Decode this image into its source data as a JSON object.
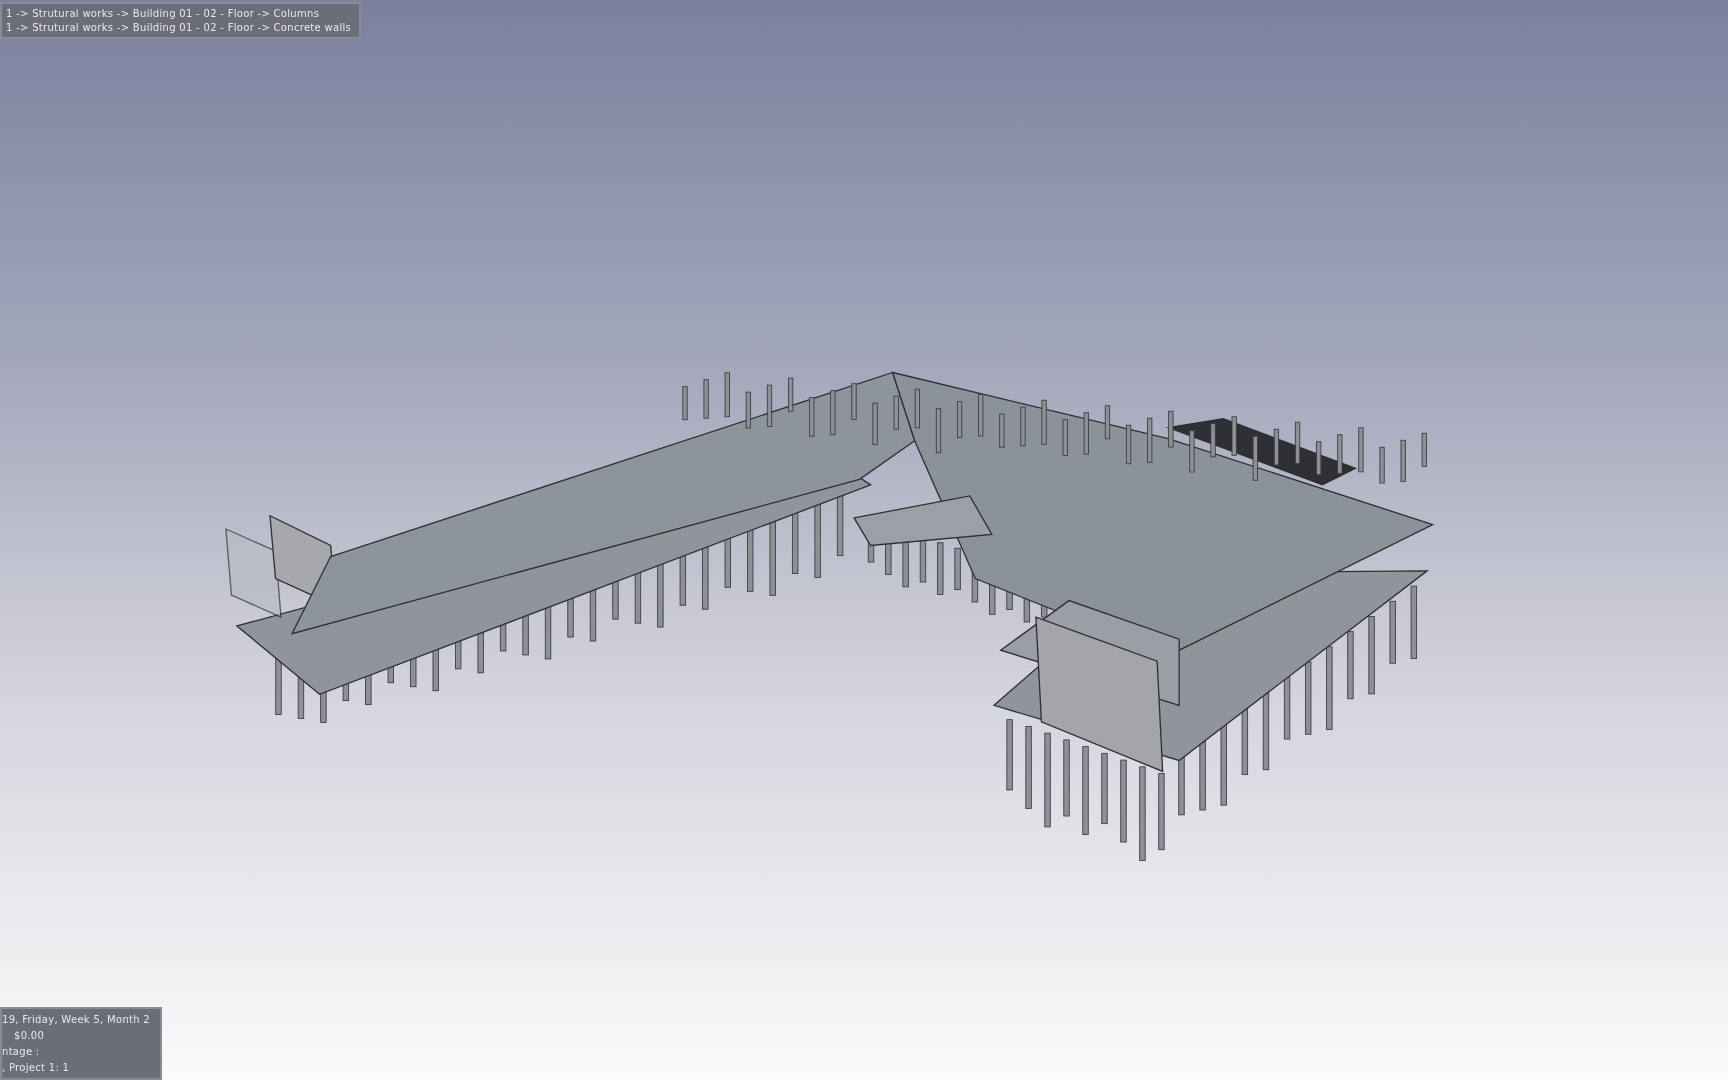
{
  "breadcrumb_panel": {
    "lines": [
      "1 -> Strutural works -> Building 01 - 02 - Floor -> Columns",
      "1 -> Strutural works -> Building 01 - 02 - Floor -> Concrete walls"
    ]
  },
  "status_panel": {
    "lines": [
      "19, Friday, Week 5, Month 2",
      "$0.00",
      "ntage :",
      ", Project 1: 1"
    ]
  }
}
